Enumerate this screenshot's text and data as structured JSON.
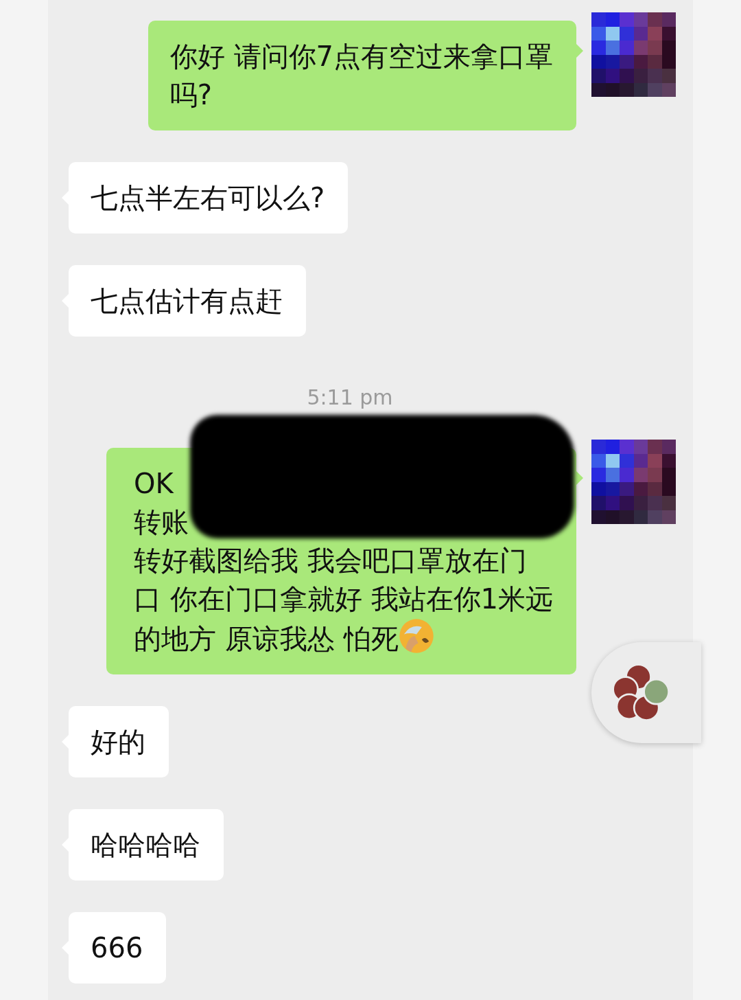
{
  "messages": [
    {
      "kind": "sent",
      "lines": [
        "你好 请问你7点有空过来拿口罩",
        "吗?"
      ]
    },
    {
      "kind": "received",
      "lines": [
        "七点半左右可以么?"
      ]
    },
    {
      "kind": "received",
      "lines": [
        "七点估计有点赶"
      ]
    },
    {
      "kind": "time",
      "text": "5:11 pm"
    },
    {
      "kind": "sent",
      "redacted": true,
      "emoji": true,
      "lines": [
        "OK",
        "转账",
        "转好截图给我 我会吧口罩放在门",
        "口 你在门口拿就好 我站在你1米远",
        "的地方 原谅我怂 怕死"
      ]
    },
    {
      "kind": "received",
      "lines": [
        "好的"
      ]
    },
    {
      "kind": "received",
      "lines": [
        "哈哈哈哈"
      ]
    },
    {
      "kind": "received",
      "lines": [
        "666"
      ]
    }
  ]
}
